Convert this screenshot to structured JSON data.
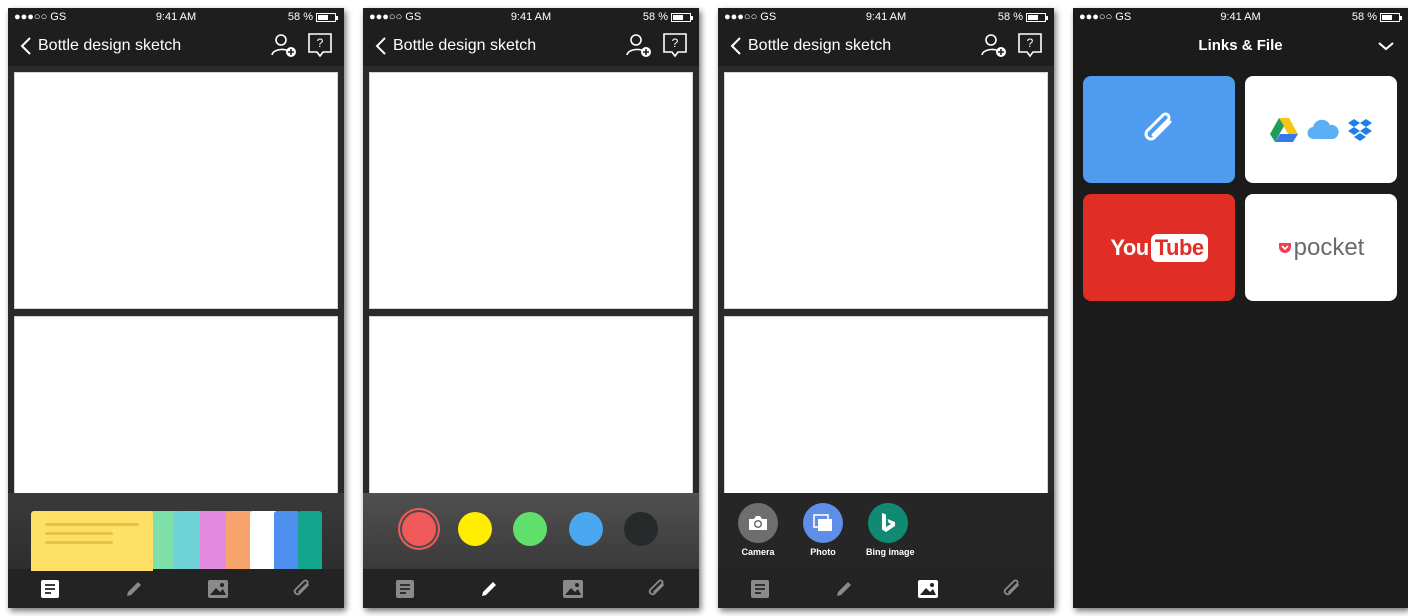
{
  "status_bar": {
    "carrier": "●●●○○ GS",
    "time": "9:41 AM",
    "battery": "58 %"
  },
  "note": {
    "title": "Bottle design sketch"
  },
  "colors": {
    "sticky": [
      "#ffe066",
      "#7ee0a8",
      "#6fd3d6",
      "#e28ae0",
      "#f7a46c",
      "#ffffff",
      "#4f8ff0",
      "#14a58f"
    ],
    "pens": [
      "#f05a5a",
      "#ffee00",
      "#5fe06a",
      "#4aa8f0",
      "#262a2a"
    ]
  },
  "insert": {
    "camera_label": "Camera",
    "photo_label": "Photo",
    "bing_label": "Bing image"
  },
  "tabs": [
    "note-icon",
    "pen-icon",
    "image-icon",
    "attachment-icon"
  ],
  "links_file": {
    "title": "Links & File",
    "tiles": [
      {
        "name": "attachment",
        "color": "#4f9bf0"
      },
      {
        "name": "cloud-storage",
        "color": "#ffffff"
      },
      {
        "name": "youtube",
        "label_you": "You",
        "label_tube": "Tube",
        "color": "#e02d25"
      },
      {
        "name": "pocket",
        "label": "pocket",
        "color": "#ffffff"
      }
    ]
  }
}
